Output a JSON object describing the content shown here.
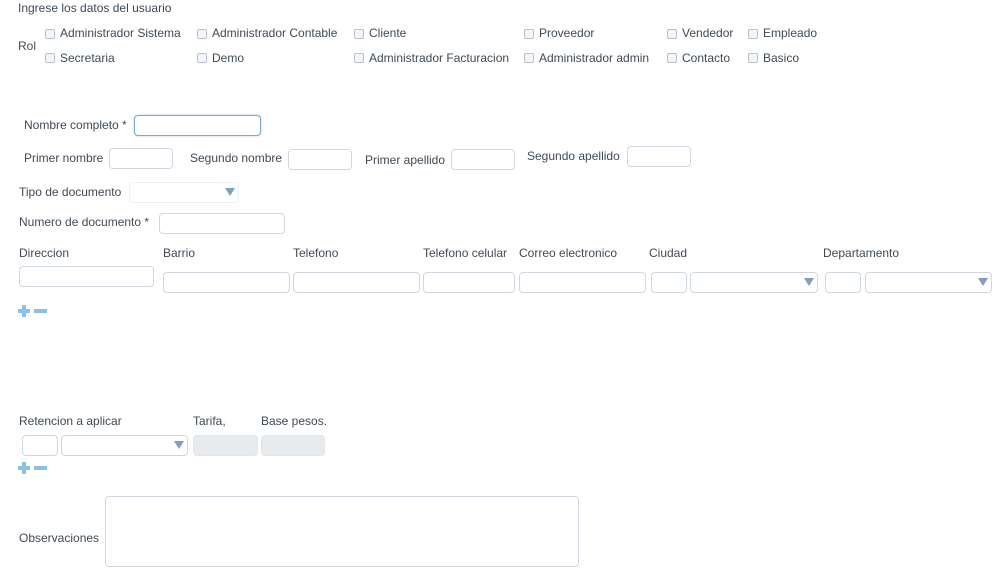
{
  "header": {
    "title": "Ingrese los datos del usuario"
  },
  "roles": {
    "label": "Rol",
    "items": [
      "Administrador Sistema",
      "Administrador Contable",
      "Cliente",
      "Proveedor",
      "Vendedor",
      "Empleado",
      "Secretaria",
      "Demo",
      "Administrador Facturacion",
      "Administrador admin",
      "Contacto",
      "Basico"
    ]
  },
  "fields": {
    "nombre_completo": "Nombre completo *",
    "primer_nombre": "Primer nombre",
    "segundo_nombre": "Segundo nombre",
    "primer_apellido": "Primer apellido",
    "segundo_apellido": "Segundo apellido",
    "tipo_documento": "Tipo de documento",
    "numero_documento": "Numero de documento *"
  },
  "address_table": {
    "headers": [
      "Direccion",
      "Barrio",
      "Telefono",
      "Telefono celular",
      "Correo electronico",
      "Ciudad",
      "Departamento"
    ]
  },
  "retention": {
    "label": "Retencion a aplicar",
    "tarifa": "Tarifa,",
    "base": "Base pesos."
  },
  "observaciones": "Observaciones",
  "colors": {
    "accent": "#8ec0e6",
    "border": "#cfd8e0",
    "text": "#3f4a56"
  },
  "icons": {
    "add": "plus-icon",
    "remove": "minus-icon",
    "dropdown": "chevron-down-icon"
  }
}
